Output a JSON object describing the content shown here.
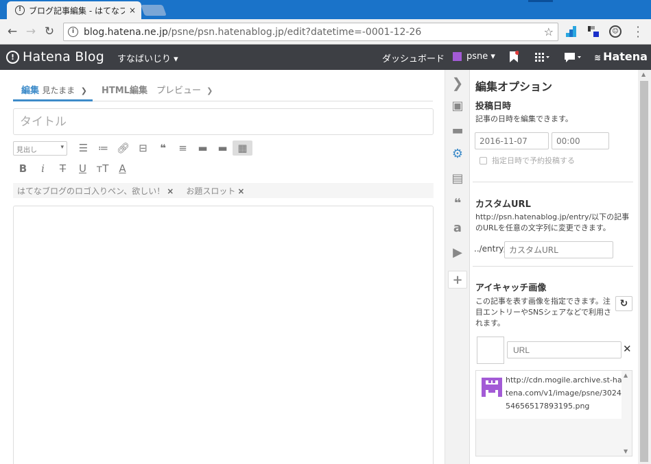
{
  "browser": {
    "tab_title": "ブログ記事編集 - はてなブログ",
    "tab_close": "×",
    "url_host": "blog.hatena.ne.jp",
    "url_path": "/psne/psn.hatenablog.jp/edit?datetime=-0001-12-26"
  },
  "header": {
    "logo": "Hatena Blog",
    "blog_name": "すなばいじり ▾",
    "dashboard": "ダッシュボード",
    "user": "psne ▾",
    "brand": "Hatena",
    "user_icon_color": "#a35bd6"
  },
  "editor": {
    "mode_tabs": [
      {
        "label": "編集",
        "sub": "見たまま"
      },
      {
        "label": "HTML編集"
      },
      {
        "label": "プレビュー"
      }
    ],
    "title_placeholder": "タイトル",
    "heading_select": "見出し",
    "format_icons": [
      "list-bullet-icon",
      "list-number-icon",
      "link-icon",
      "more-icon",
      "quote-icon",
      "indent-icon",
      "folder-icon",
      "folder-icon",
      "table-icon"
    ],
    "tags": [
      {
        "label": "はてなブログのロゴ入りペン、欲しい！"
      },
      {
        "label": "お題スロット"
      }
    ],
    "tag_remove": "×"
  },
  "options": {
    "title": "編集オプション",
    "datetime": {
      "title": "投稿日時",
      "desc": "記事の日時を編集できます。",
      "date_placeholder": "2016-11-07",
      "time_placeholder": "00:00",
      "schedule_label": "指定日時で予約投稿する"
    },
    "custom_url": {
      "title": "カスタムURL",
      "desc": "http://psn.hatenablog.jp/entry/以下の記事のURLを任意の文字列に変更できます。",
      "prefix": "../entry/",
      "placeholder": "カスタムURL"
    },
    "eyecatch": {
      "title": "アイキャッチ画像",
      "desc": "この記事を表す画像を指定できます。注目エントリーやSNSシェアなどで利用されます。",
      "url_placeholder": "URL",
      "image_src": "http://cdn.mogile.archive.st-hatena.com/v1/image/psne/302454656517893195.png"
    }
  },
  "colors": {
    "accent": "#3d8bc9",
    "header_bg": "#3d3f44",
    "chrome_blue": "#1a73c9"
  }
}
